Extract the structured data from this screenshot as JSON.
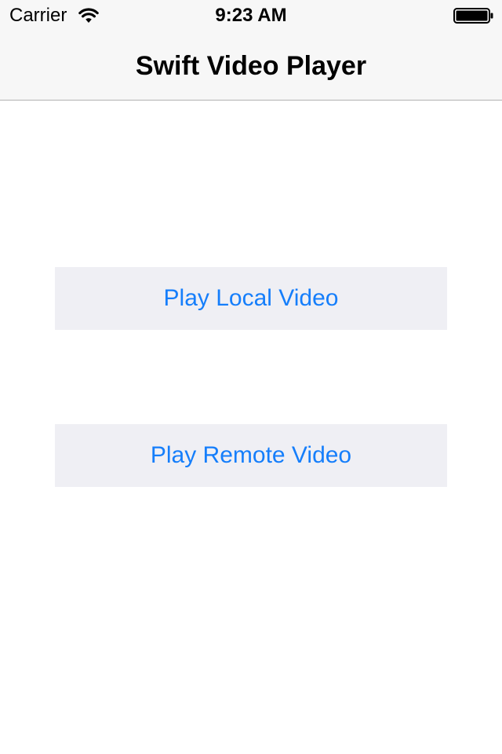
{
  "status_bar": {
    "carrier": "Carrier",
    "time": "9:23 AM",
    "wifi_icon": "wifi-icon",
    "battery_icon": "battery-icon"
  },
  "nav": {
    "title": "Swift Video Player"
  },
  "buttons": {
    "local_label": "Play Local Video",
    "remote_label": "Play Remote Video"
  },
  "colors": {
    "accent": "#157efb",
    "button_background": "#efeff4",
    "nav_background": "#f7f7f7"
  }
}
